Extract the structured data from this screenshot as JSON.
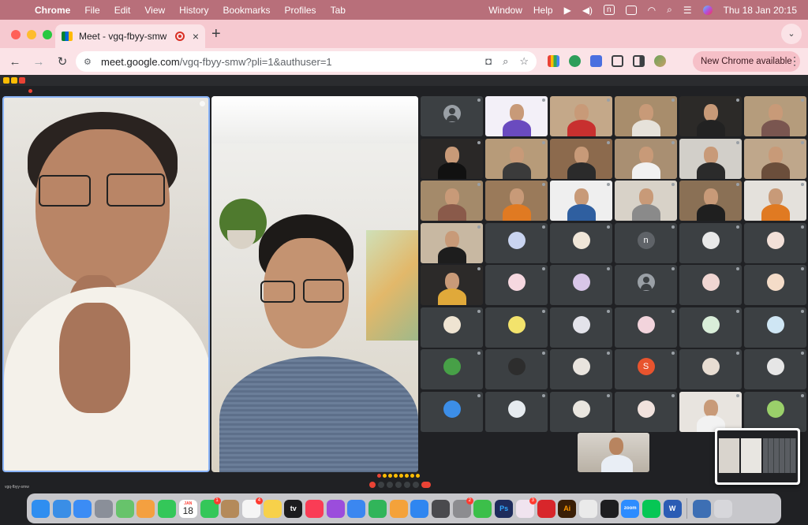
{
  "menubar": {
    "app": "Chrome",
    "items": [
      "File",
      "Edit",
      "View",
      "History",
      "Bookmarks",
      "Profiles",
      "Tab"
    ],
    "right_items": [
      "Window",
      "Help"
    ],
    "input_badge": "n",
    "clock": "Thu 18 Jan  20:15"
  },
  "tab": {
    "title": "Meet - vgq-fbyy-smw",
    "close": "×",
    "new_tab": "+",
    "dropdown": "⌄"
  },
  "toolbar": {
    "back": "←",
    "forward": "→",
    "reload": "↻",
    "tune": "⚙",
    "url_host": "meet.google.com",
    "url_path": "/vgq-fbyy-smw?pli=1&authuser=1",
    "cam_icon": "◘",
    "zoom_icon": "⌕",
    "star": "☆",
    "update_label": "New Chrome available",
    "menu": "⋮"
  },
  "meet": {
    "meeting_code": "vgq-fbyy-smw",
    "presenter_1": "",
    "presenter_2": ""
  },
  "colors": {
    "menubar": "#b86f7a",
    "tabstrip": "#f6c9d0",
    "toolbar": "#fbe3e7",
    "meet_bg": "#202124",
    "tile": "#3c4043",
    "accent": "#8ab4f8"
  },
  "grid": {
    "rows": [
      [
        {
          "type": "avatar",
          "style": "grey",
          "name": ""
        },
        {
          "type": "video",
          "tone": "#f3f0f8",
          "body": "#6a4bbf",
          "name": ""
        },
        {
          "type": "video",
          "tone": "#c4a889",
          "body": "#c8302f",
          "name": ""
        },
        {
          "type": "video",
          "tone": "#a88d6c",
          "body": "#e6e2da",
          "name": ""
        },
        {
          "type": "video",
          "tone": "#2c2a28",
          "body": "#222",
          "name": ""
        },
        {
          "type": "video",
          "tone": "#b59c7c",
          "body": "#7a5650",
          "name": ""
        }
      ],
      [
        {
          "type": "video",
          "tone": "#2a2827",
          "body": "#111",
          "name": ""
        },
        {
          "type": "video",
          "tone": "#b79b79",
          "body": "#3b3b3b",
          "name": ""
        },
        {
          "type": "video",
          "tone": "#8c6a4d",
          "body": "#2b2b2b",
          "name": ""
        },
        {
          "type": "video",
          "tone": "#a98f72",
          "body": "#f1f1f1",
          "name": ""
        },
        {
          "type": "video",
          "tone": "#d2cfc9",
          "body": "#2b2b2b",
          "name": ""
        },
        {
          "type": "video",
          "tone": "#bfa78b",
          "body": "#6b4e3b",
          "name": ""
        }
      ],
      [
        {
          "type": "video",
          "tone": "#a48a6a",
          "body": "#8a5a4a",
          "name": ""
        },
        {
          "type": "video",
          "tone": "#9a7a5a",
          "body": "#e07a22",
          "name": ""
        },
        {
          "type": "video",
          "tone": "#efefef",
          "body": "#2f5fa0",
          "name": ""
        },
        {
          "type": "video",
          "tone": "#d8d2c8",
          "body": "#8a8a8a",
          "name": ""
        },
        {
          "type": "video",
          "tone": "#8a7055",
          "body": "#1f1f1f",
          "name": ""
        },
        {
          "type": "video",
          "tone": "#e4e1dc",
          "body": "#e07a22",
          "name": ""
        }
      ],
      [
        {
          "type": "video",
          "tone": "#c8b8a2",
          "body": "#1d1d1d",
          "name": ""
        },
        {
          "type": "avatar",
          "style": "#c9d4f0",
          "name": ""
        },
        {
          "type": "avatar",
          "style": "#f0e6d8",
          "name": ""
        },
        {
          "type": "avatar",
          "style": "letter",
          "letter": "n",
          "color": "#5f6368",
          "name": ""
        },
        {
          "type": "avatar",
          "style": "#e9e9e9",
          "name": ""
        },
        {
          "type": "avatar",
          "style": "#f2e0d8",
          "name": ""
        }
      ],
      [
        {
          "type": "video",
          "tone": "#2c2a29",
          "body": "#e0a93a",
          "name": ""
        },
        {
          "type": "avatar",
          "style": "#f6d8e0",
          "name": ""
        },
        {
          "type": "avatar",
          "style": "#d8c6e8",
          "name": ""
        },
        {
          "type": "avatar",
          "style": "grey",
          "name": ""
        },
        {
          "type": "avatar",
          "style": "#f0d6d2",
          "name": ""
        },
        {
          "type": "avatar",
          "style": "#f4dcc8",
          "name": ""
        }
      ],
      [
        {
          "type": "avatar",
          "style": "#efe4d2",
          "name": ""
        },
        {
          "type": "avatar",
          "style": "#f3e36c",
          "name": ""
        },
        {
          "type": "avatar",
          "style": "#e3e3ea",
          "name": ""
        },
        {
          "type": "avatar",
          "style": "#f2d4dc",
          "name": ""
        },
        {
          "type": "avatar",
          "style": "#d9eed9",
          "name": ""
        },
        {
          "type": "avatar",
          "style": "#cfe6f4",
          "name": ""
        }
      ],
      [
        {
          "type": "avatar",
          "style": "#47a047",
          "name": ""
        },
        {
          "type": "avatar",
          "style": "#2d2d2d",
          "name": ""
        },
        {
          "type": "avatar",
          "style": "#e9e4de",
          "name": ""
        },
        {
          "type": "avatar",
          "style": "letter",
          "letter": "S",
          "color": "#e8542e",
          "name": ""
        },
        {
          "type": "avatar",
          "style": "#e8ddd2",
          "name": ""
        },
        {
          "type": "avatar",
          "style": "#e6e6e6",
          "name": ""
        }
      ],
      [
        {
          "type": "avatar",
          "style": "#3c8ee8",
          "name": ""
        },
        {
          "type": "avatar",
          "style": "#e6ebef",
          "name": ""
        },
        {
          "type": "avatar",
          "style": "#e9e6df",
          "name": ""
        },
        {
          "type": "avatar",
          "style": "#f1e2dd",
          "name": ""
        },
        {
          "type": "video",
          "tone": "#e8e4df",
          "body": "#f2f2f2",
          "name": ""
        },
        {
          "type": "avatar",
          "style": "#9ad06a",
          "name": ""
        }
      ]
    ]
  },
  "dock": {
    "calendar_month": "JAN",
    "calendar_day": "18",
    "apps": [
      {
        "name": "finder",
        "color": "#2f8ef0",
        "badge": ""
      },
      {
        "name": "safari",
        "color": "#3a8ee6",
        "badge": ""
      },
      {
        "name": "mail",
        "color": "#3b8cf5",
        "badge": ""
      },
      {
        "name": "launchpad",
        "color": "#8a8f99",
        "badge": ""
      },
      {
        "name": "maps",
        "color": "#67c36b",
        "badge": ""
      },
      {
        "name": "photos",
        "color": "#f4a040",
        "badge": ""
      },
      {
        "name": "facetime",
        "color": "#34c759",
        "badge": ""
      },
      {
        "name": "calendar",
        "color": "#ffffff",
        "badge": ""
      },
      {
        "name": "messages",
        "color": "#34c759",
        "badge": "1"
      },
      {
        "name": "contacts",
        "color": "#b48a5a",
        "badge": ""
      },
      {
        "name": "reminders",
        "color": "#f5f5f5",
        "badge": "4"
      },
      {
        "name": "notes",
        "color": "#f7d14a",
        "badge": ""
      },
      {
        "name": "tv",
        "color": "#1c1c1e",
        "badge": ""
      },
      {
        "name": "music",
        "color": "#fa3c55",
        "badge": ""
      },
      {
        "name": "podcasts",
        "color": "#9b4ddc",
        "badge": ""
      },
      {
        "name": "keynote",
        "color": "#3b87f0",
        "badge": ""
      },
      {
        "name": "numbers",
        "color": "#31b55a",
        "badge": ""
      },
      {
        "name": "pages",
        "color": "#f4a23a",
        "badge": ""
      },
      {
        "name": "app-store",
        "color": "#2f86f0",
        "badge": ""
      },
      {
        "name": "quicktime",
        "color": "#4a4a4e",
        "badge": ""
      },
      {
        "name": "system-settings",
        "color": "#8c8c90",
        "badge": "2"
      },
      {
        "name": "utorrent",
        "color": "#3cbf4a",
        "badge": ""
      },
      {
        "name": "photoshop",
        "color": "#1e2c5c",
        "badge": ""
      },
      {
        "name": "slack",
        "color": "#f0e4ef",
        "badge": "3"
      },
      {
        "name": "acrobat",
        "color": "#d8262b",
        "badge": ""
      },
      {
        "name": "illustrator",
        "color": "#3a1e06",
        "badge": ""
      },
      {
        "name": "chrome",
        "color": "#eaeaea",
        "badge": ""
      },
      {
        "name": "terminal",
        "color": "#1d1d1f",
        "badge": ""
      },
      {
        "name": "zoom",
        "color": "#2d8cff",
        "badge": ""
      },
      {
        "name": "line",
        "color": "#06c755",
        "badge": ""
      },
      {
        "name": "word",
        "color": "#2b5cb4",
        "badge": ""
      },
      {
        "name": "finder-folder",
        "color": "#3d6fb4",
        "badge": ""
      },
      {
        "name": "trash",
        "color": "#d7d7db",
        "badge": ""
      }
    ],
    "glyphs": {
      "photoshop": "Ps",
      "illustrator": "Ai",
      "zoom": "zoom",
      "word": "W",
      "tv": "tv"
    }
  }
}
